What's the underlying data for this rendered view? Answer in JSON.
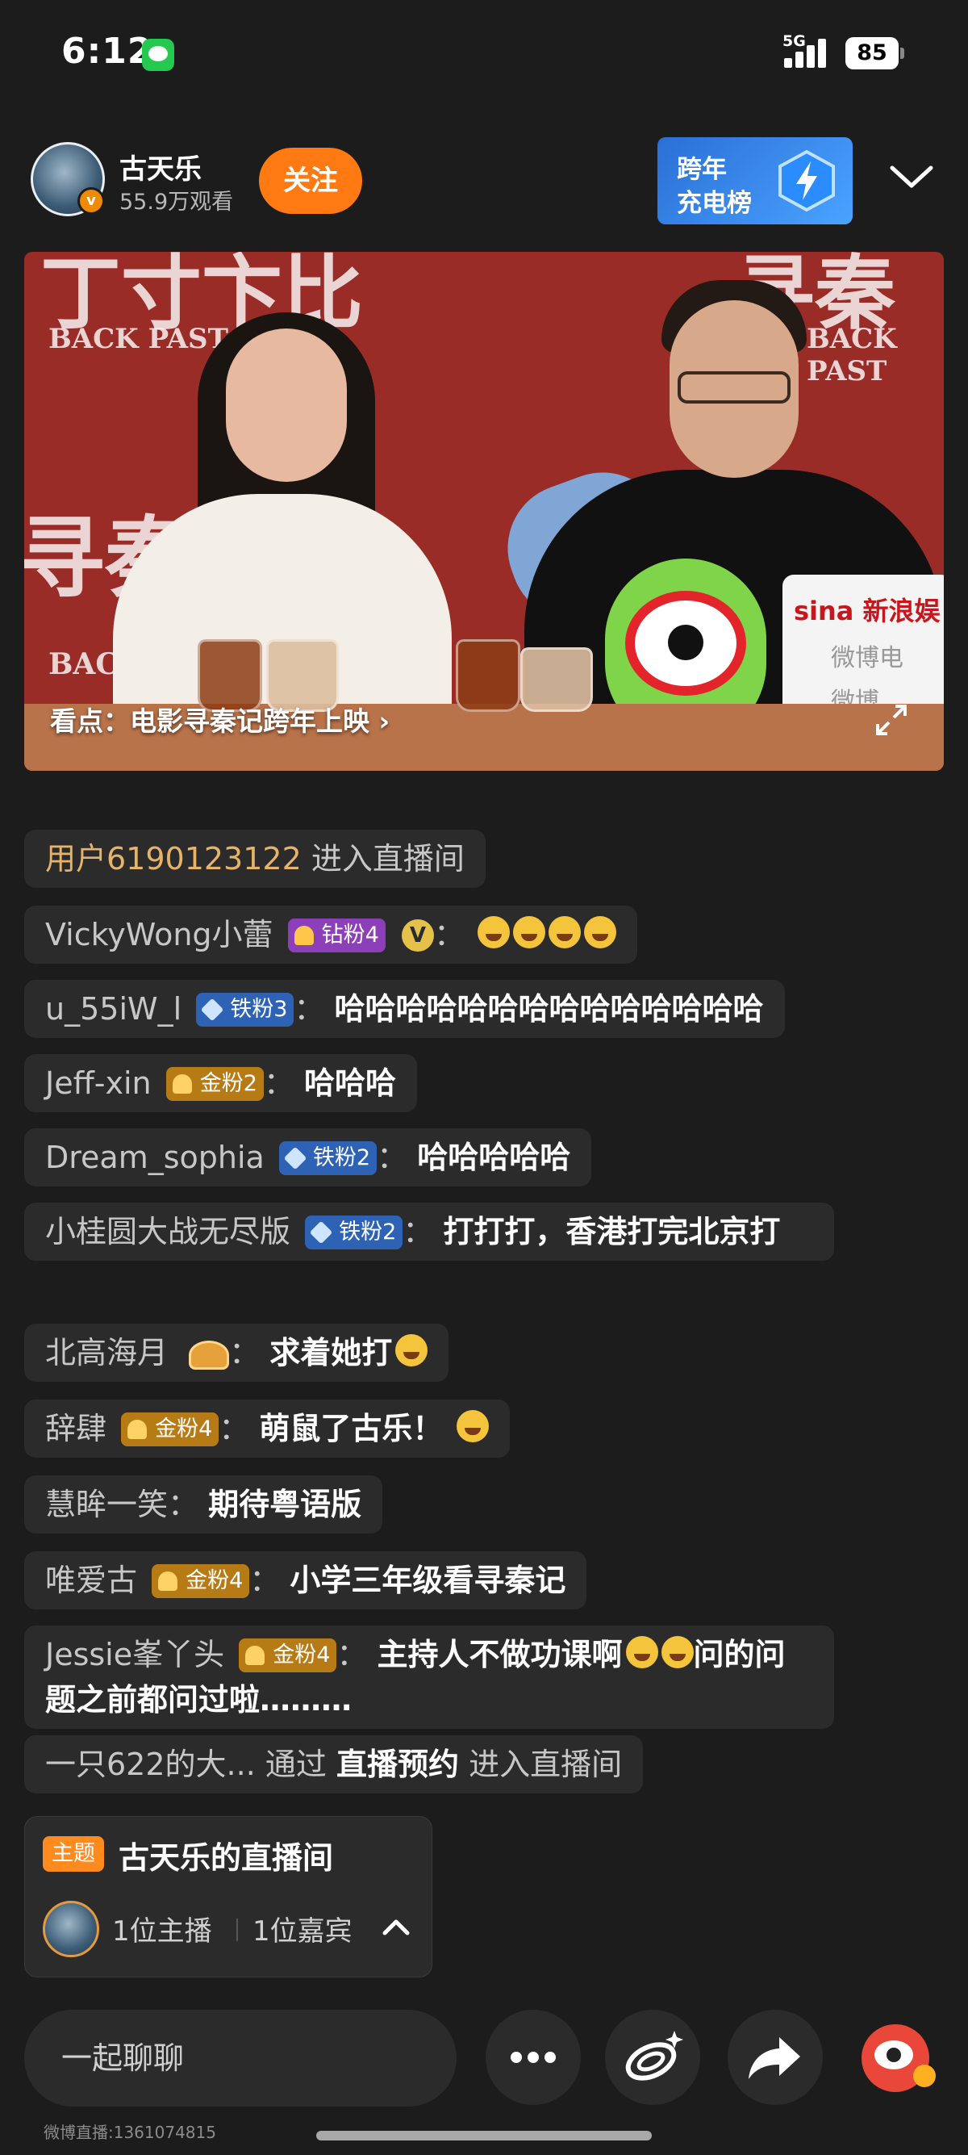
{
  "status_bar": {
    "time": "6:12",
    "network": "5G",
    "battery": "85",
    "message_app_icon": "green-message-icon"
  },
  "header": {
    "host_name": "古天乐",
    "viewers": "55.9万观看",
    "follow_label": "关注",
    "rank_line1": "跨年",
    "rank_line2": "充电榜"
  },
  "video": {
    "headline": "看点：电影寻秦记跨年上映 ›",
    "bg_text_top_left": "丁寸卞比",
    "bg_text_top_right": "寻秦",
    "bg_text_back_left": "BACK PAST",
    "bg_text_back_right": "BACK PAST",
    "bg_text_mid_left": "寻秦",
    "bg_text_bottom_left": "BACK",
    "sign_text": "sina 新浪娱",
    "sign_text_2": "微博电",
    "sign_text_3": "微博"
  },
  "chat": {
    "enter1_user": "用户6190123122",
    "enter1_text": "进入直播间",
    "m1_user": "VickyWong小蕾",
    "m1_badge": "钻粉4",
    "m1_vip": "V",
    "m2_user": "u_55iW_l",
    "m2_badge": "铁粉3",
    "m2_text": "哈哈哈哈哈哈哈哈哈哈哈哈哈哈",
    "m3_user": "Jeff-xin",
    "m3_badge": "金粉2",
    "m3_text": "哈哈哈",
    "m4_user": "Dream_sophia",
    "m4_badge": "铁粉2",
    "m4_text": "哈哈哈哈哈",
    "m5_user": "小桂圆大战无尽版",
    "m5_badge": "铁粉2",
    "m5_text": "打打打，香港打完北京打",
    "m6_user": "北高海月",
    "m6_text": "求着她打",
    "m7_user": "辞肆",
    "m7_badge": "金粉4",
    "m7_text": "萌鼠了古乐！",
    "m8_user": "慧眸一笑",
    "m8_text": "期待粤语版",
    "m9_user": "唯爱古",
    "m9_badge": "金粉4",
    "m9_text": "小学三年级看寻秦记",
    "m10_user": "Jessie峯丫头",
    "m10_badge": "金粉4",
    "m10_text_a": "主持人不做功课啊",
    "m10_text_b": "问的问题之前都问过啦………",
    "enter2_user": "一只622的大...",
    "enter2_via": "通过",
    "enter2_source": "直播预约",
    "enter2_text": "进入直播间",
    "colon": "："
  },
  "room_card": {
    "topic_tag": "主题",
    "title": "古天乐的直播间",
    "hosts": "1位主播",
    "guests": "1位嘉宾"
  },
  "bottom_bar": {
    "chat_placeholder": "一起聊聊",
    "stream_id": "微博直播:1361074815"
  },
  "colors": {
    "background": "#1c1c1c",
    "chat_bubble": "#2b2b2b",
    "follow_orange": "#ff7a12",
    "enter_user_gold": "#e5b36a",
    "rank_blue": "#2a6fd6"
  }
}
